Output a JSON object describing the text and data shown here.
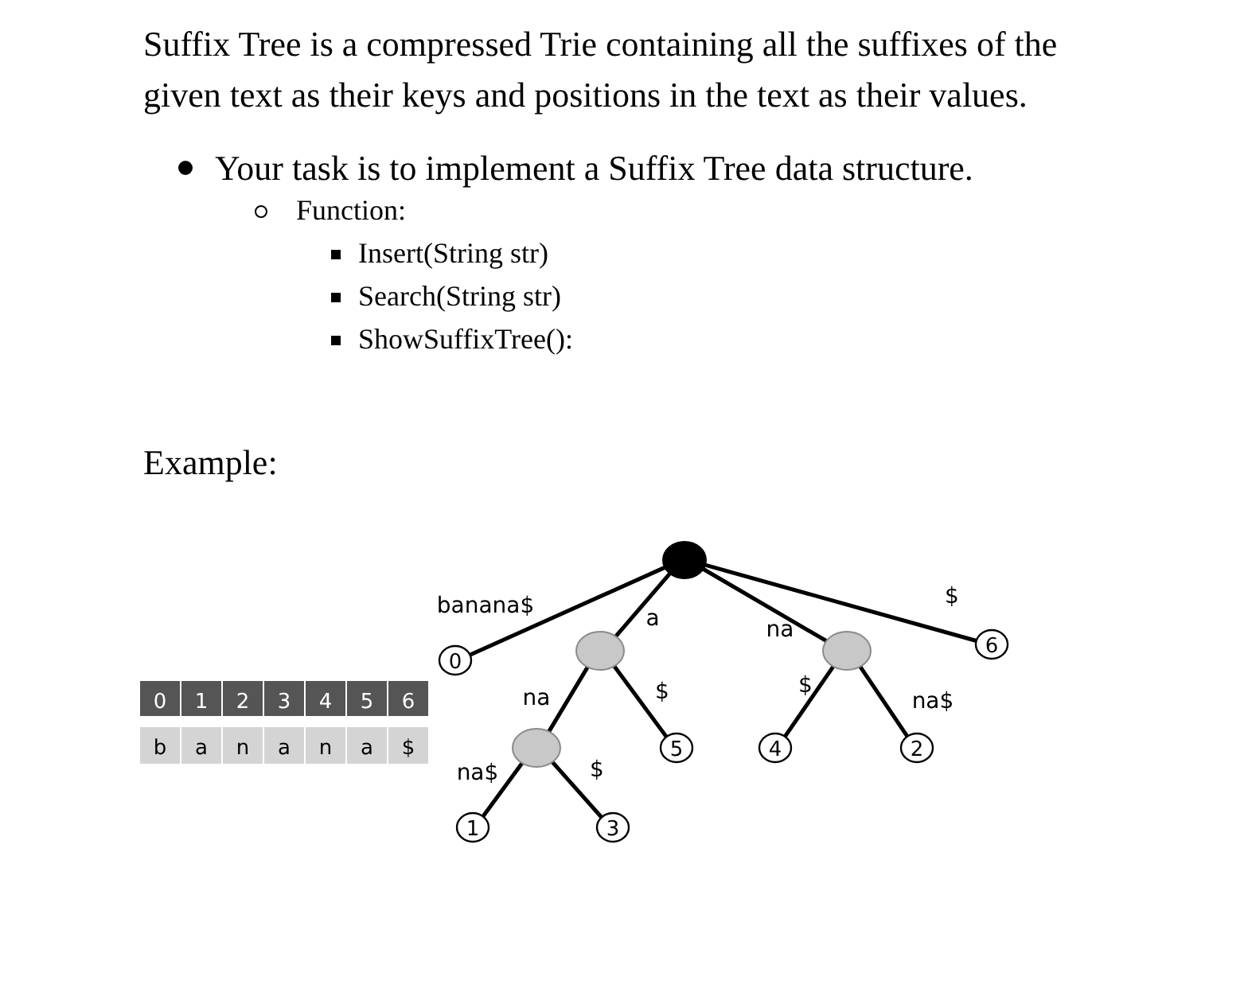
{
  "intro": "Suffix Tree is a compressed Trie containing all the suffixes of the given text as their keys and positions in the text as their values.",
  "tasks": [
    {
      "text": "Your task is to implement a Suffix Tree data structure.",
      "children": [
        {
          "text": "Function:",
          "children": [
            {
              "text": "Insert(String str)"
            },
            {
              "text": "Search(String str)"
            },
            {
              "text": "ShowSuffixTree():"
            }
          ]
        }
      ]
    }
  ],
  "example_heading": "Example:",
  "figure": {
    "indices": [
      "0",
      "1",
      "2",
      "3",
      "4",
      "5",
      "6"
    ],
    "characters": [
      "b",
      "a",
      "n",
      "a",
      "n",
      "a",
      "$"
    ],
    "tree": {
      "children": [
        {
          "edge": "banana$",
          "leaf": "0"
        },
        {
          "edge": "a",
          "children": [
            {
              "edge": "na",
              "children": [
                {
                  "edge": "na$",
                  "leaf": "1"
                },
                {
                  "edge": "$",
                  "leaf": "3"
                }
              ]
            },
            {
              "edge": "$",
              "leaf": "5"
            }
          ]
        },
        {
          "edge": "na",
          "children": [
            {
              "edge": "$",
              "leaf": "4"
            },
            {
              "edge": "na$",
              "leaf": "2"
            }
          ]
        },
        {
          "edge": "$",
          "leaf": "6"
        }
      ]
    }
  }
}
